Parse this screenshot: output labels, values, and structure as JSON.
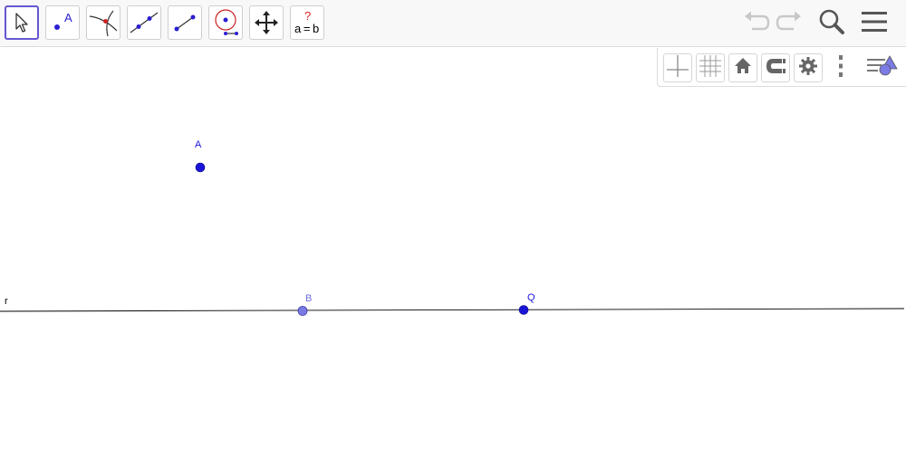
{
  "toolbar": {
    "tools": [
      {
        "name": "move-tool",
        "icon": "arrow-pointer-icon",
        "active": true
      },
      {
        "name": "point-tool",
        "icon": "point-icon",
        "label": "A"
      },
      {
        "name": "intersect-tool",
        "icon": "intersect-icon"
      },
      {
        "name": "line-tool",
        "icon": "line-through-points-icon"
      },
      {
        "name": "segment-tool",
        "icon": "segment-icon"
      },
      {
        "name": "circle-tool",
        "icon": "circle-center-point-icon"
      },
      {
        "name": "move-graphics-view-tool",
        "icon": "move-arrows-icon"
      },
      {
        "name": "relation-tool",
        "icon": "relation-icon",
        "label_top": "?",
        "label_bottom": "a = b"
      }
    ],
    "undo_icon": "undo-icon",
    "redo_icon": "redo-icon",
    "search_icon": "search-icon",
    "menu_icon": "hamburger-menu-icon"
  },
  "style_bar": {
    "buttons": [
      "axes-toggle-icon",
      "grid-toggle-icon",
      "home-icon",
      "snap-magnet-icon",
      "gear-icon",
      "more-vertical-icon",
      "toggle-style-bar-icon"
    ]
  },
  "construction": {
    "points": [
      {
        "name": "A",
        "color": "#1a14d6"
      },
      {
        "name": "B",
        "color": "#6c6cd8"
      },
      {
        "name": "Q",
        "color": "#1a14d6"
      }
    ],
    "line": {
      "name": "r",
      "color": "#000000"
    }
  },
  "colors": {
    "accent": "#6557d2",
    "point_dark": "#1a14d6",
    "point_light": "#7b7be6"
  }
}
